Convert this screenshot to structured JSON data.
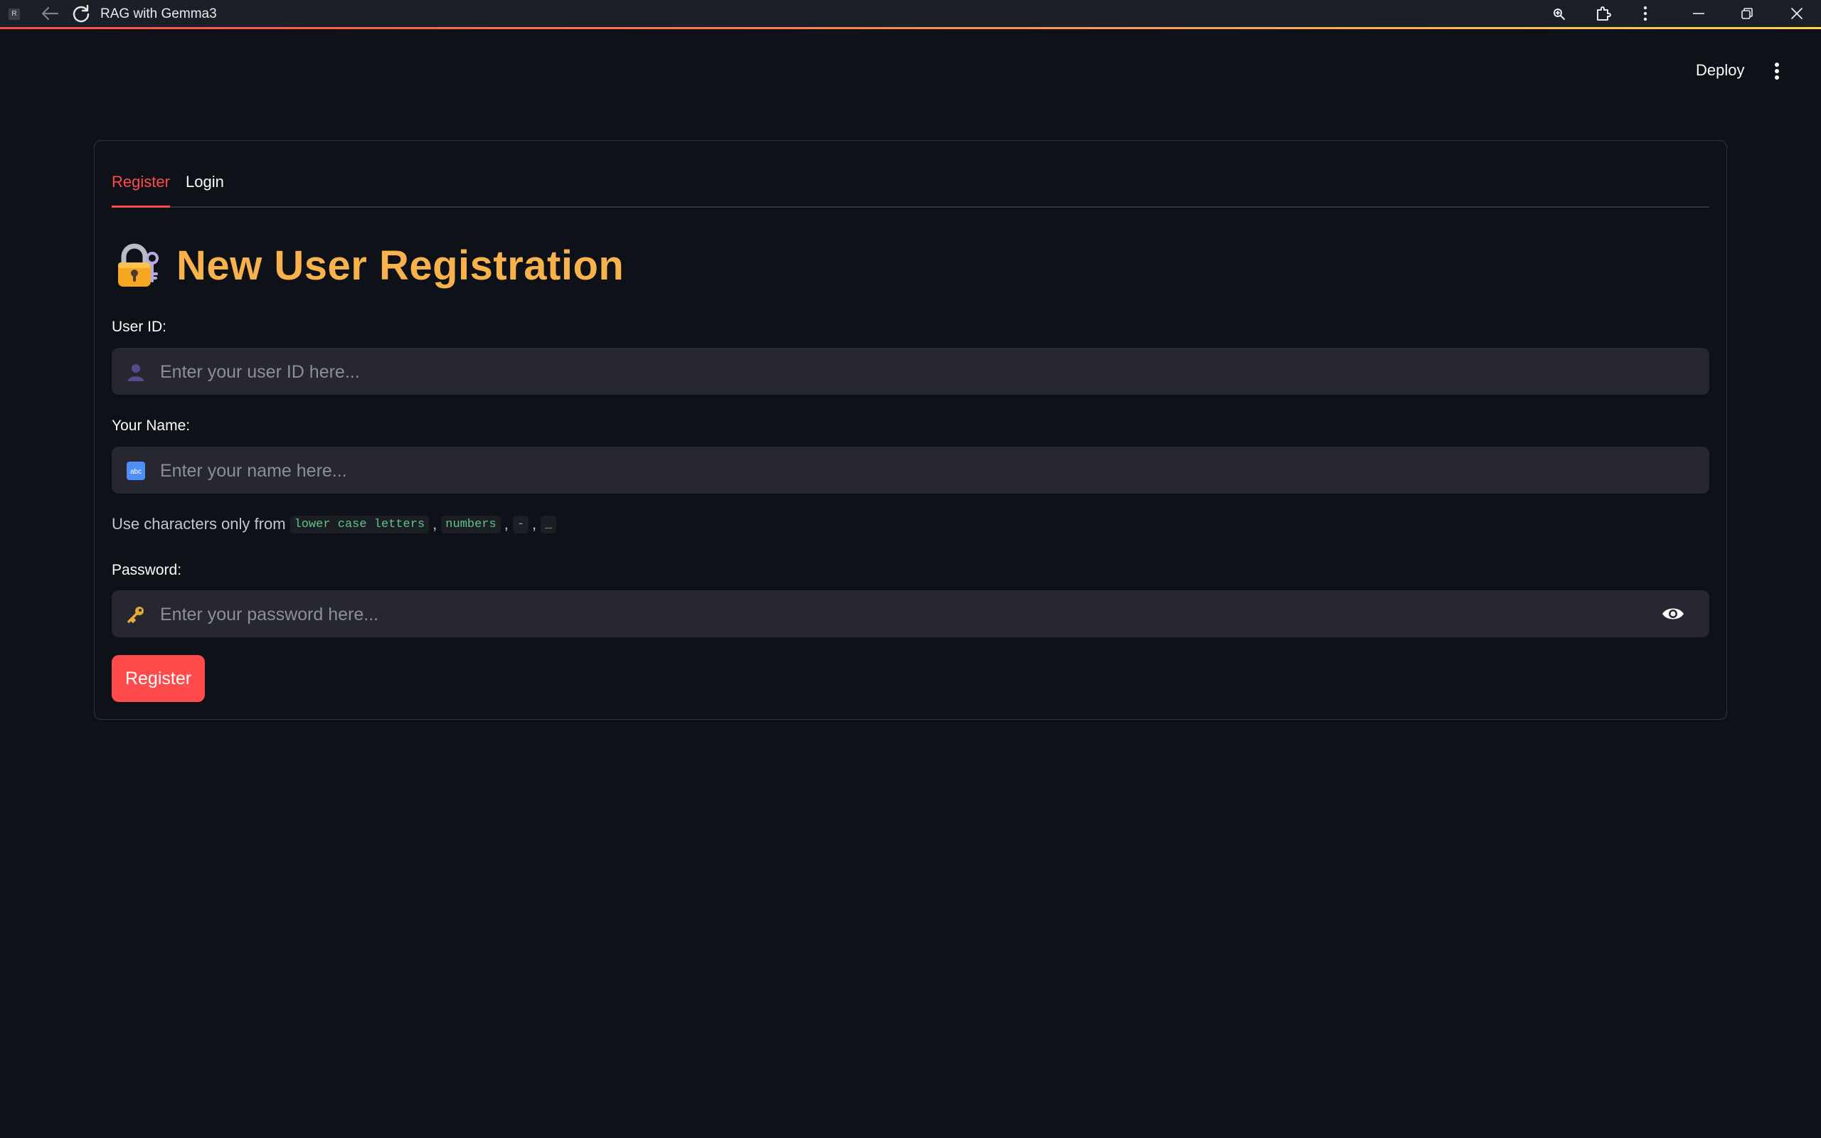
{
  "window": {
    "title": "RAG with Gemma3",
    "app_icon_letter": "R"
  },
  "header": {
    "deploy_label": "Deploy"
  },
  "tabs": [
    {
      "label": "Register",
      "active": true
    },
    {
      "label": "Login",
      "active": false
    }
  ],
  "form": {
    "heading": "New User Registration",
    "user_id": {
      "label": "User ID:",
      "placeholder": "Enter your user ID here...",
      "value": ""
    },
    "name": {
      "label": "Your Name:",
      "placeholder": "Enter your name here...",
      "value": ""
    },
    "hint": {
      "prefix": "Use characters only from",
      "tokens": [
        "lower case letters",
        "numbers",
        "-",
        "_"
      ]
    },
    "password": {
      "label": "Password:",
      "placeholder": "Enter your password here...",
      "value": ""
    },
    "submit_label": "Register"
  },
  "colors": {
    "background": "#0e1117",
    "accent": "#ff4b4b",
    "heading": "#f8b24b",
    "input_bg": "#262730",
    "code_text": "#5ec487"
  },
  "icons": {
    "user_id_field": "person-silhouette-icon",
    "name_field": "abc-icon",
    "password_field": "key-icon",
    "heading": "locked-with-key-icon",
    "password_toggle": "eye-icon"
  }
}
